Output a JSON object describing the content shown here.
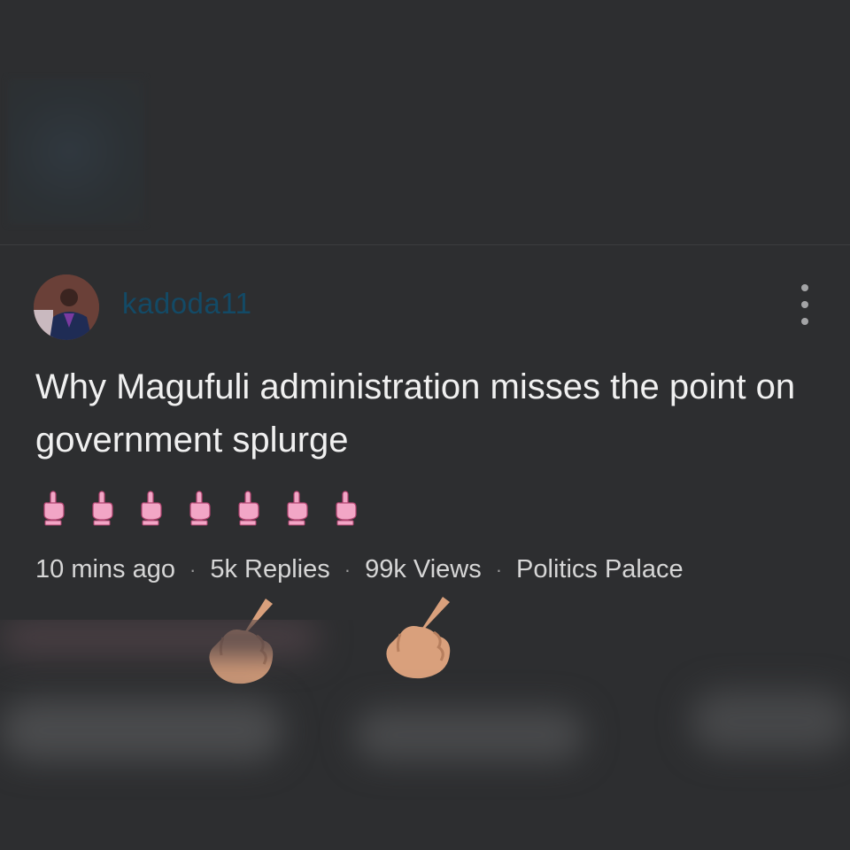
{
  "post": {
    "username": "kadoda11",
    "title": "Why Magufuli administration misses the point on government splurge",
    "emoji_count": 7,
    "meta": {
      "time": "10 mins ago",
      "replies": "5k Replies",
      "views": "99k Views",
      "category": "Politics Palace",
      "separator": "·"
    }
  },
  "icons": {
    "avatar": "user-avatar",
    "more": "more-vertical-icon",
    "emoji": "pointing-up-hand-emoji",
    "pointer": "pointing-hand-emoji"
  },
  "colors": {
    "background": "#2d2e30",
    "username": "#134a66",
    "title": "#f0f0f0",
    "meta": "#d6d6d6",
    "emoji_pink": "#f2a6c6",
    "skin": "#d9a07c"
  }
}
